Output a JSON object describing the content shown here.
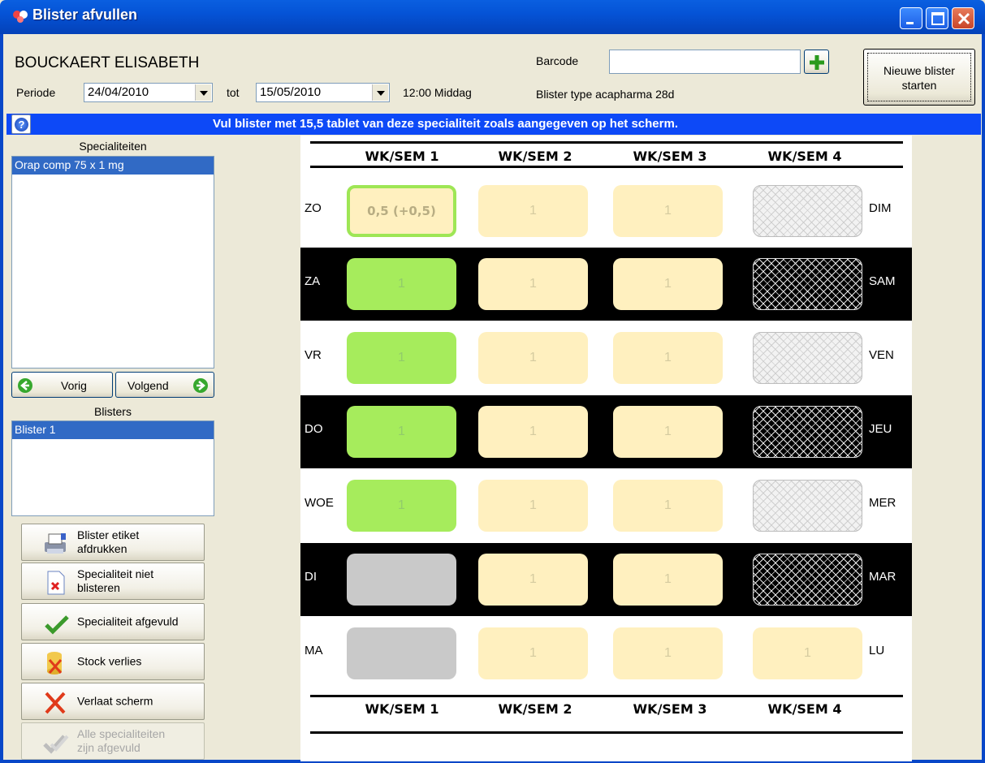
{
  "window": {
    "title": "Blister afvullen"
  },
  "header": {
    "patient_name": "BOUCKAERT ELISABETH",
    "periode_label": "Periode",
    "date_from": "24/04/2010",
    "tot_label": "tot",
    "date_to": "15/05/2010",
    "time_label": "12:00 Middag",
    "barcode_label": "Barcode",
    "barcode_value": "",
    "blister_type_label": "Blister type",
    "blister_type_value": "acapharma 28d",
    "new_blister_label": "Nieuwe blister starten"
  },
  "banner": {
    "text": "Vul blister met 15,5 tablet van deze specialiteit zoals aangegeven op het scherm."
  },
  "sidebar": {
    "specialiteiten_title": "Specialiteiten",
    "specialiteiten": [
      "Orap comp  75 x 1 mg"
    ],
    "prev_label": "Vorig",
    "next_label": "Volgend",
    "blisters_title": "Blisters",
    "blisters": [
      "Blister 1"
    ],
    "actions": {
      "print_label": "Blister etiket afdrukken",
      "skip_label": "Specialiteit niet blisteren",
      "done_label": "Specialiteit afgevuld",
      "stock_label": "Stock verlies",
      "exit_label": "Verlaat scherm",
      "all_done_label": "Alle specialiteiten zijn afgevuld"
    }
  },
  "grid": {
    "week_headers": [
      "WK/SEM 1",
      "WK/SEM 2",
      "WK/SEM 3",
      "WK/SEM 4"
    ],
    "rows": [
      {
        "left": "ZO",
        "right": "DIM",
        "cells": [
          "0,5 (+0,5)",
          "1",
          "1",
          ""
        ]
      },
      {
        "left": "ZA",
        "right": "SAM",
        "cells": [
          "1",
          "1",
          "1",
          ""
        ]
      },
      {
        "left": "VR",
        "right": "VEN",
        "cells": [
          "1",
          "1",
          "1",
          ""
        ]
      },
      {
        "left": "DO",
        "right": "JEU",
        "cells": [
          "1",
          "1",
          "1",
          ""
        ]
      },
      {
        "left": "WOE",
        "right": "MER",
        "cells": [
          "1",
          "1",
          "1",
          ""
        ]
      },
      {
        "left": "DI",
        "right": "MAR",
        "cells": [
          "",
          "1",
          "1",
          ""
        ]
      },
      {
        "left": "MA",
        "right": "LU",
        "cells": [
          "",
          "1",
          "1",
          "1"
        ]
      }
    ]
  },
  "colors": {
    "banner": "#0d49f7",
    "filled": "#a6ec5c",
    "pending": "#fff0bf",
    "unused": "#c9c9c9",
    "selection": "#316ac5"
  }
}
